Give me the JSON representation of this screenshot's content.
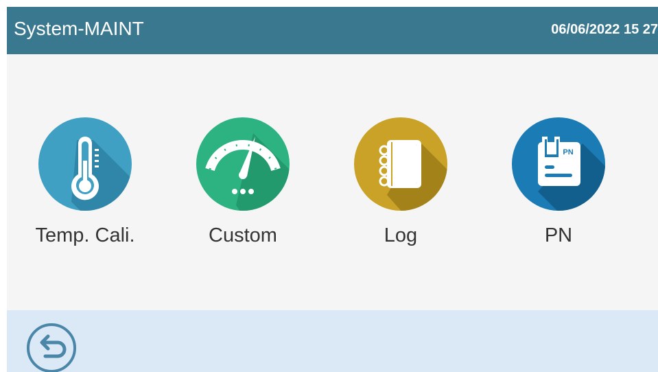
{
  "header": {
    "title": "System-MAINT",
    "datetime": "06/06/2022 15 27"
  },
  "colors": {
    "header_bg": "#3a7890",
    "content_bg": "#f5f5f5",
    "footer_bg": "#dbe8f6",
    "temp_icon": "#3fa0c4",
    "custom_icon": "#2db382",
    "log_icon": "#c9a227",
    "pn_icon": "#1a7bb5",
    "back_icon": "#4a86a8"
  },
  "menu": {
    "items": [
      {
        "label": "Temp. Cali.",
        "icon": "thermometer-icon"
      },
      {
        "label": "Custom",
        "icon": "gauge-icon"
      },
      {
        "label": "Log",
        "icon": "notebook-icon"
      },
      {
        "label": "PN",
        "icon": "pn-document-icon",
        "icon_text": "PN"
      }
    ]
  },
  "footer": {
    "back_icon": "back-arrow-icon"
  }
}
